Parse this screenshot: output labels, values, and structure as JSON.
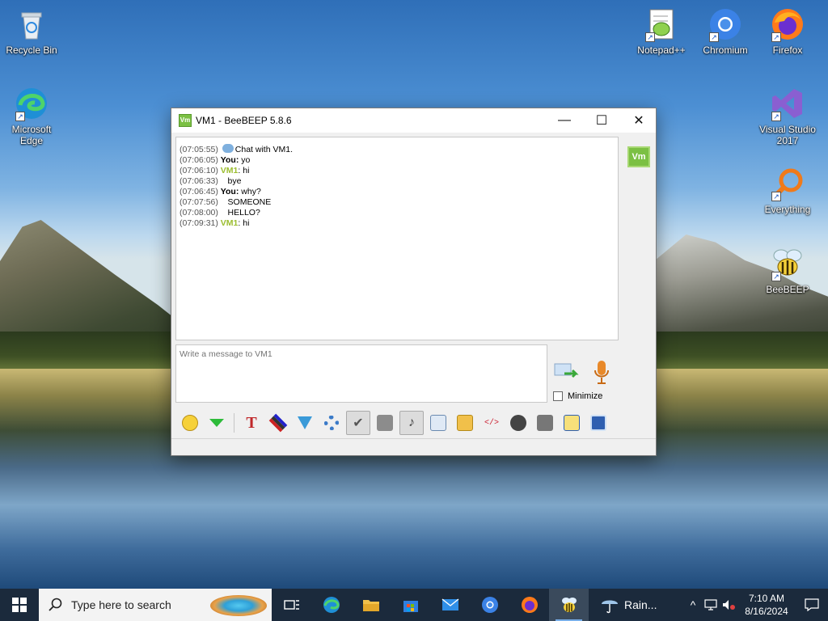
{
  "desktop": {
    "icons": {
      "recycle_bin": "Recycle Bin",
      "edge": "Microsoft Edge",
      "notepad": "Notepad++",
      "chromium": "Chromium",
      "firefox": "Firefox",
      "vstudio": "Visual Studio 2017",
      "everything": "Everything",
      "beebeep": "BeeBEEP"
    }
  },
  "window": {
    "title": "VM1 - BeeBEEP 5.8.6",
    "app_icon_text": "Vm",
    "controls": {
      "minimize": "—",
      "maximize": "☐",
      "close": "✕"
    },
    "chat": [
      {
        "ts": "(07:05:55)",
        "text": "Chat with VM1."
      },
      {
        "ts": "(07:06:05)",
        "sender": "You:",
        "text": " yo"
      },
      {
        "ts": "(07:06:10)",
        "sender": "VM1",
        "text": ": hi"
      },
      {
        "ts": "(07:06:33)",
        "text": "bye"
      },
      {
        "ts": "(07:06:45)",
        "sender": "You:",
        "text": " why?"
      },
      {
        "ts": "(07:07:56)",
        "text": "SOMEONE"
      },
      {
        "ts": "(07:08:00)",
        "text": "HELLO?"
      },
      {
        "ts": "(07:09:31)",
        "sender": "VM1",
        "text": ": hi"
      }
    ],
    "input_placeholder": "Write a message to VM1",
    "minimize_label": "Minimize",
    "side_badge": "Vm"
  },
  "taskbar": {
    "search_placeholder": "Type here to search",
    "weather": "Rain...",
    "time": "7:10 AM",
    "date": "8/16/2024"
  },
  "colors": {
    "vm_name": "#9bbd2f",
    "beebeep_green": "#7bc043",
    "taskbar": "#1b2a3c"
  }
}
